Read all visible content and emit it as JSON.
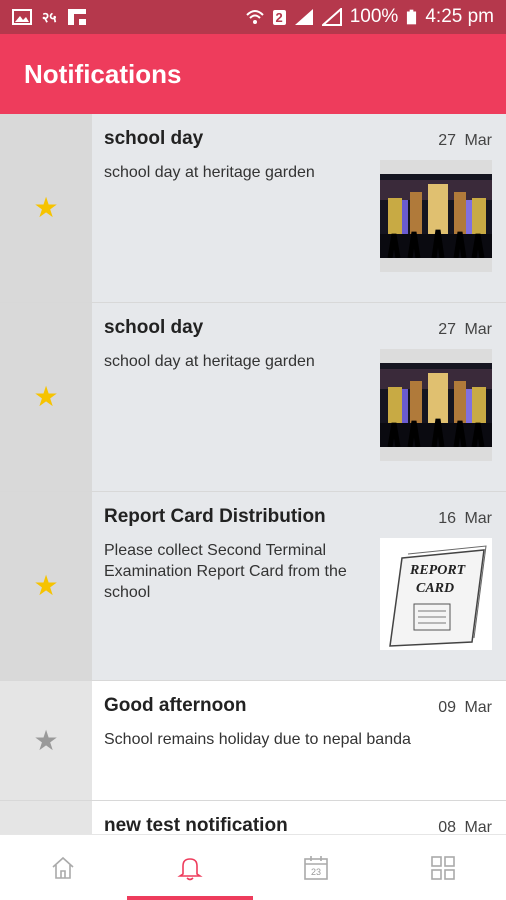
{
  "status_bar": {
    "left_icons": [
      "image-icon",
      "data-saver-icon",
      "flipboard-icon"
    ],
    "right_icons": [
      "wifi-icon",
      "sim-2-icon",
      "signal-icon",
      "signal-icon-2"
    ],
    "battery": "100%",
    "time": "4:25 pm"
  },
  "app_bar": {
    "title": "Notifications",
    "color": "#ee3c5c"
  },
  "notifications": [
    {
      "title": "school day",
      "date": "27 Mar",
      "body": "school day at heritage garden",
      "starred": true,
      "read": false,
      "thumb": "heritage-garden-photo"
    },
    {
      "title": "school day",
      "date": "27 Mar",
      "body": "school day at heritage garden",
      "starred": true,
      "read": false,
      "thumb": "heritage-garden-photo"
    },
    {
      "title": "Report Card Distribution",
      "date": "16 Mar",
      "body": "Please collect Second Terminal Examination Report Card from the school",
      "starred": true,
      "read": false,
      "thumb": "report-card-image",
      "thumb_text": [
        "REPORT",
        "CARD"
      ]
    },
    {
      "title": "Good afternoon",
      "date": "09 Mar",
      "body": "School remains holiday due to nepal banda",
      "starred": false,
      "read": true
    },
    {
      "title": "new test notification",
      "date": "08 Mar",
      "body": "",
      "starred": false,
      "read": true
    }
  ],
  "tabs": [
    {
      "name": "home-icon",
      "active": false
    },
    {
      "name": "bell-icon",
      "active": true
    },
    {
      "name": "calendar-icon",
      "label": "23",
      "active": false
    },
    {
      "name": "grid-icon",
      "active": false
    }
  ]
}
